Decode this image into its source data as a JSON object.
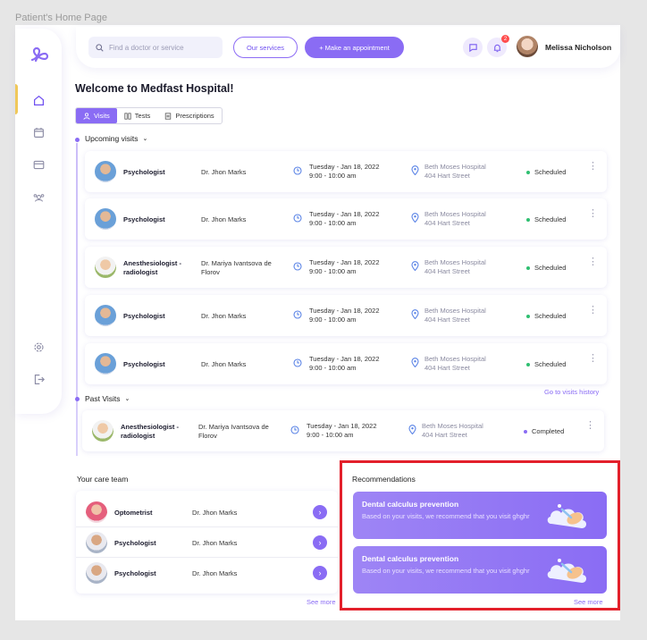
{
  "page_label": "Patient's Home Page",
  "header": {
    "search_placeholder": "Find a doctor or service",
    "our_services": "Our services",
    "make_appointment": "+ Make an appointment",
    "notification_count": "2",
    "user_name": "Melissa Nicholson"
  },
  "welcome": "Welcome to Medfast Hospital!",
  "tabs": [
    "Visits",
    "Tests",
    "Prescriptions"
  ],
  "upcoming_label": "Upcoming visits",
  "upcoming": [
    {
      "specialty": "Psychologist",
      "doctor": "Dr. Jhon Marks",
      "day": "Tuesday - Jan 18, 2022",
      "time": "9:00 - 10:00 am",
      "hospital": "Beth Moses Hospital",
      "address": "404 Hart Street",
      "status": "Scheduled"
    },
    {
      "specialty": "Psychologist",
      "doctor": "Dr. Jhon Marks",
      "day": "Tuesday - Jan 18, 2022",
      "time": "9:00 - 10:00 am",
      "hospital": "Beth Moses Hospital",
      "address": "404 Hart Street",
      "status": "Scheduled"
    },
    {
      "specialty": "Anesthesiologist - radiologist",
      "doctor": "Dr. Mariya Ivantsova de Florov",
      "day": "Tuesday - Jan 18, 2022",
      "time": "9:00 - 10:00 am",
      "hospital": "Beth Moses Hospital",
      "address": "404 Hart Street",
      "status": "Scheduled"
    },
    {
      "specialty": "Psychologist",
      "doctor": "Dr. Jhon Marks",
      "day": "Tuesday - Jan 18, 2022",
      "time": "9:00 - 10:00 am",
      "hospital": "Beth Moses Hospital",
      "address": "404 Hart Street",
      "status": "Scheduled"
    },
    {
      "specialty": "Psychologist",
      "doctor": "Dr. Jhon Marks",
      "day": "Tuesday - Jan 18, 2022",
      "time": "9:00 - 10:00 am",
      "hospital": "Beth Moses Hospital",
      "address": "404 Hart Street",
      "status": "Scheduled"
    }
  ],
  "past_label": "Past Visits",
  "go_to_history": "Go to visits history",
  "past": [
    {
      "specialty": "Anesthesiologist - radiologist",
      "doctor": "Dr. Mariya Ivantsova de Florov",
      "day": "Tuesday - Jan 18, 2022",
      "time": "9:00 - 10:00 am",
      "hospital": "Beth Moses Hospital",
      "address": "404 Hart Street",
      "status": "Completed"
    }
  ],
  "care_team_label": "Your care team",
  "care_team": [
    {
      "specialty": "Optometrist",
      "doctor": "Dr. Jhon Marks"
    },
    {
      "specialty": "Psychologist",
      "doctor": "Dr. Jhon Marks"
    },
    {
      "specialty": "Psychologist",
      "doctor": "Dr. Jhon Marks"
    }
  ],
  "care_see_more": "See more",
  "recommendations_label": "Recommendations",
  "recommendations": [
    {
      "title": "Dental calculus prevention",
      "text": "Based on your visits, we recommend that you visit ghghr"
    },
    {
      "title": "Dental calculus prevention",
      "text": "Based on your visits, we recommend that you visit ghghr"
    }
  ],
  "rec_see_more": "See more",
  "colors": {
    "accent": "#8a6cf4",
    "scheduled": "#2fbf71",
    "completed": "#8a6cf4",
    "highlight": "#e3202b"
  }
}
